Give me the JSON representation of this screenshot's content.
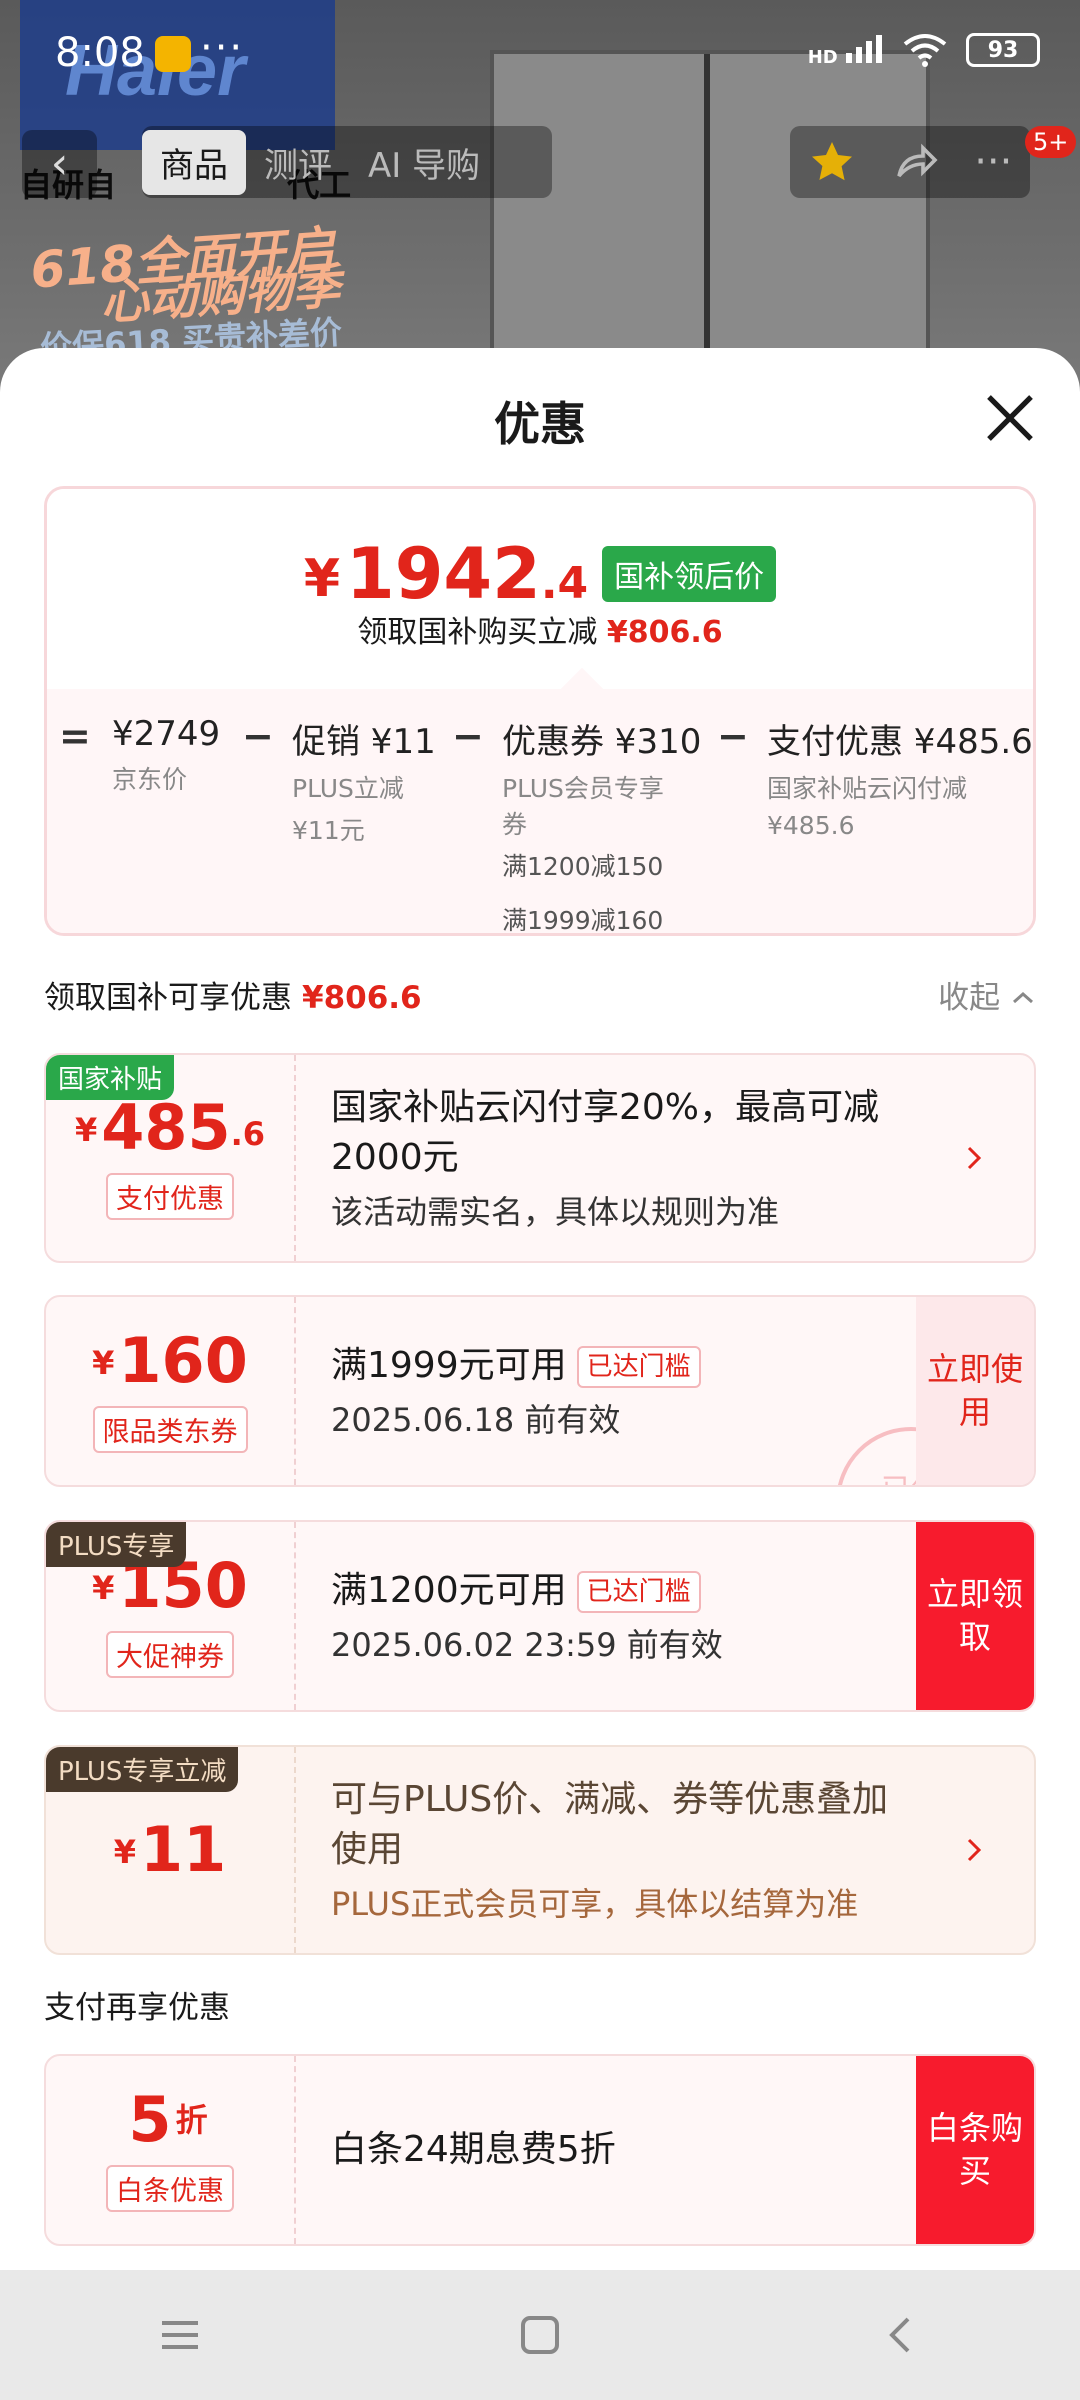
{
  "status_bar": {
    "time": "8:08",
    "dots": "···",
    "signal": "HD",
    "battery": "93"
  },
  "background": {
    "brand": "Haier",
    "strip": "自研自",
    "strip_end": "代工",
    "promo_line1": "618全面开启",
    "promo_line2": "心动购物季",
    "promo_line3": "价保618 买贵补差价"
  },
  "nav": {
    "tabs": [
      "商品",
      "测评",
      "AI 导购"
    ],
    "badge": "5+"
  },
  "sheet": {
    "title": "优惠",
    "summary": {
      "price_yen": "¥",
      "price_int": "1942",
      "price_dec": ".4",
      "price_tag": "国补领后价",
      "sub_text": "领取国补购买立减",
      "sub_amount": "¥806.6",
      "breakdown": [
        {
          "op": "=",
          "title": "¥2749",
          "lines": [
            "京东价"
          ]
        },
        {
          "op": "−",
          "title": "促销 ¥11",
          "lines": [
            "PLUS立减",
            "¥11元"
          ]
        },
        {
          "op": "−",
          "title": "优惠券 ¥310",
          "lines": [
            "PLUS会员专享",
            "券",
            "满1200减150",
            "满1999减160"
          ]
        },
        {
          "op": "−",
          "title": "支付优惠 ¥485.6",
          "lines": [
            "国家补贴云闪付减",
            "¥485.6"
          ]
        }
      ]
    },
    "section": {
      "title": "领取国补可享优惠",
      "amount": "¥806.6",
      "toggle": "收起"
    },
    "coupons": [
      {
        "corner": "国家补贴",
        "yen": "¥",
        "num": "485",
        "dec": ".6",
        "tag": "支付优惠",
        "main": "国家补贴云闪付享20%，最高可减2000元",
        "sub": "该活动需实名，具体以规则为准"
      },
      {
        "yen": "¥",
        "num": "160",
        "tag": "限品类东券",
        "main": "满1999元可用",
        "badge": "已达门槛",
        "sub": "2025.06.18 前有效",
        "action": "立即使用",
        "stamp": "已领"
      },
      {
        "corner": "PLUS专享",
        "yen": "¥",
        "num": "150",
        "tag": "大促神券",
        "main": "满1200元可用",
        "badge": "已达门槛",
        "sub": "2025.06.02 23:59 前有效",
        "action": "立即领取"
      },
      {
        "corner": "PLUS专享立减",
        "yen": "¥",
        "num": "11",
        "main": "可与PLUS价、满减、券等优惠叠加使用",
        "sub": "PLUS正式会员可享，具体以结算为准"
      }
    ],
    "pay_section": {
      "title": "支付再享优惠"
    },
    "pay_coupon": {
      "num": "5",
      "unit": "折",
      "tag": "白条优惠",
      "main": "白条24期息费5折",
      "action": "白条购买"
    }
  },
  "colors": {
    "accent": "#e1251b",
    "green": "#2aa84a",
    "plus": "#4a3a2c"
  }
}
